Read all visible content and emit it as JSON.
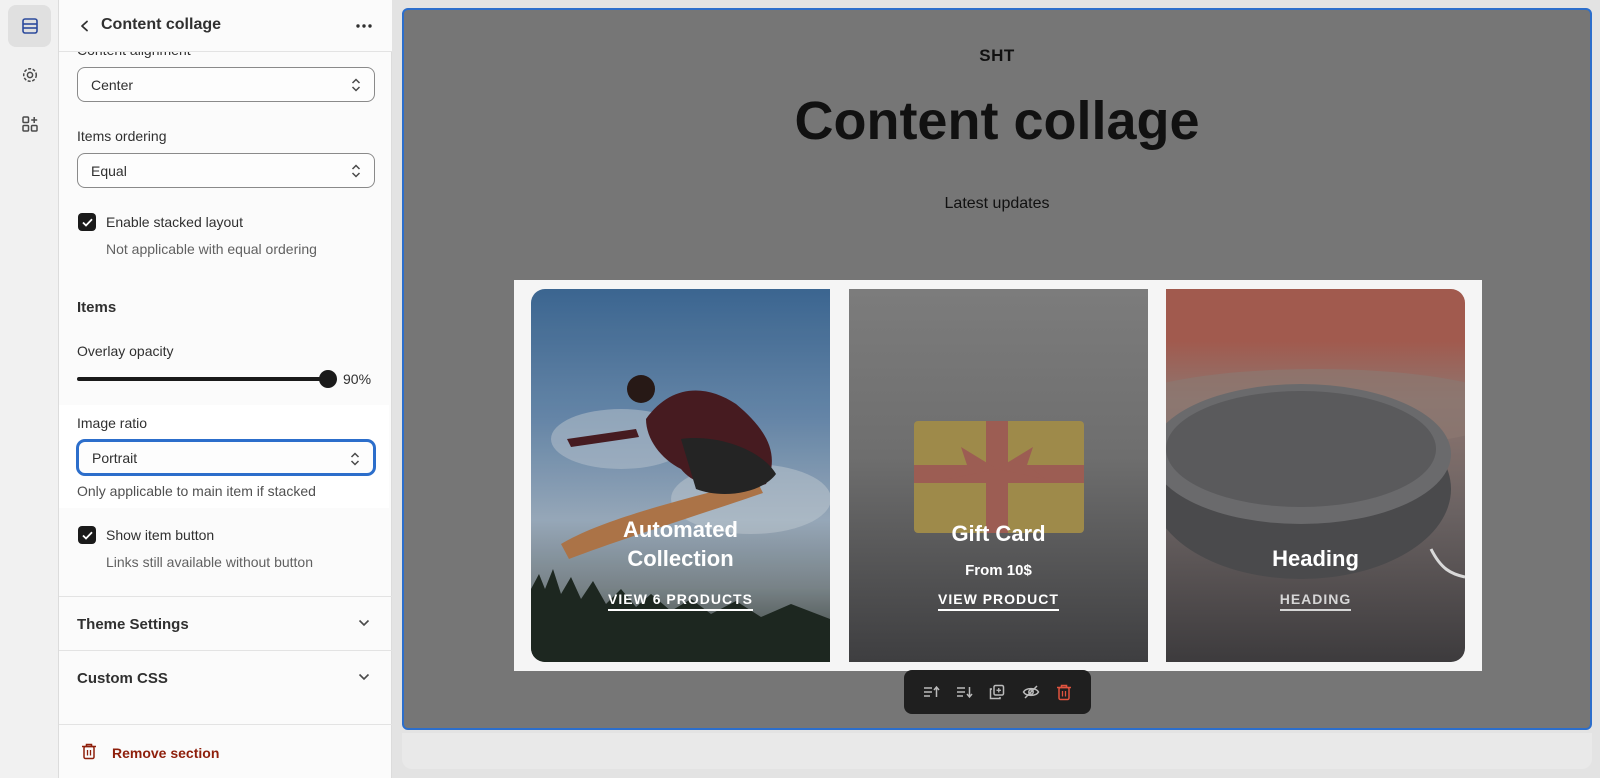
{
  "rail": {
    "items": [
      {
        "icon": "sections-icon",
        "active": true
      },
      {
        "icon": "gear-icon",
        "active": false
      },
      {
        "icon": "apps-icon",
        "active": false
      }
    ]
  },
  "panel": {
    "title": "Content collage",
    "content_alignment": {
      "label": "Content alignment",
      "value": "Center"
    },
    "items_ordering": {
      "label": "Items ordering",
      "value": "Equal"
    },
    "stacked_layout": {
      "label": "Enable stacked layout",
      "help": "Not applicable with equal ordering",
      "checked": true
    },
    "items_heading": "Items",
    "overlay_opacity": {
      "label": "Overlay opacity",
      "value": "90%",
      "level": 0.9
    },
    "image_ratio": {
      "label": "Image ratio",
      "value": "Portrait",
      "help": "Only applicable to main item if stacked"
    },
    "show_item_button": {
      "label": "Show item button",
      "help": "Links still available without button",
      "checked": true
    },
    "theme_settings": "Theme Settings",
    "custom_css": "Custom CSS",
    "remove_section": "Remove section"
  },
  "preview": {
    "brand": "SHT",
    "title": "Content collage",
    "subtitle": "Latest updates",
    "cards": [
      {
        "title_line1": "Automated",
        "title_line2": "Collection",
        "link": "VIEW 6 PRODUCTS"
      },
      {
        "title": "Gift Card",
        "text": "From 10$",
        "link": "VIEW PRODUCT"
      },
      {
        "title": "Heading",
        "link": "HEADING"
      }
    ]
  },
  "colors": {
    "accent": "#2c6ecb",
    "danger": "#8e1f0b",
    "toolbar": "#1f1f1f"
  }
}
